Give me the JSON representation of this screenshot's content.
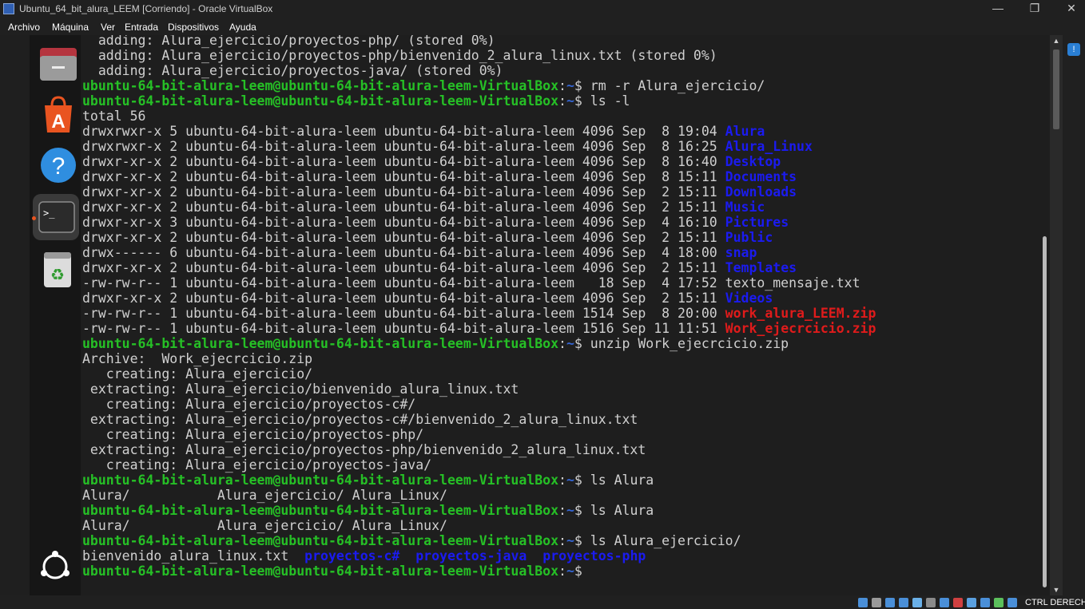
{
  "window": {
    "title": "Ubuntu_64_bit_alura_LEEM [Corriendo] - Oracle VirtualBox",
    "controls": {
      "minimize": "—",
      "restore": "❐",
      "close": "✕"
    }
  },
  "menubar": {
    "items": [
      "Archivo",
      "Máquina",
      "Ver",
      "Entrada",
      "Dispositivos",
      "Ayuda"
    ]
  },
  "dock": {
    "items": [
      {
        "name": "files",
        "icon": "folder-icon"
      },
      {
        "name": "app-center",
        "icon": "store-icon"
      },
      {
        "name": "help",
        "icon": "help-icon"
      },
      {
        "name": "terminal",
        "icon": "terminal-icon",
        "active": true
      },
      {
        "name": "trash",
        "icon": "trash-icon"
      }
    ],
    "show_apps": "apps-grid-icon"
  },
  "terminal": {
    "user_host": "ubuntu-64-bit-alura-leem@ubuntu-64-bit-alura-leem-VirtualBox",
    "path": "~",
    "lines": [
      [
        {
          "t": "  adding: Alura_ejercicio/proyectos-php/ (stored 0%)"
        }
      ],
      [
        {
          "t": "  adding: Alura_ejercicio/proyectos-php/bienvenido_2_alura_linux.txt (stored 0%)"
        }
      ],
      [
        {
          "t": "  adding: Alura_ejercicio/proyectos-java/ (stored 0%)"
        }
      ],
      [
        {
          "t": "ubuntu-64-bit-alura-leem@ubuntu-64-bit-alura-leem-VirtualBox",
          "c": "prompt"
        },
        {
          "t": ":"
        },
        {
          "t": "~",
          "c": "path"
        },
        {
          "t": "$ rm -r Alura_ejercicio/"
        }
      ],
      [
        {
          "t": "ubuntu-64-bit-alura-leem@ubuntu-64-bit-alura-leem-VirtualBox",
          "c": "prompt"
        },
        {
          "t": ":"
        },
        {
          "t": "~",
          "c": "path"
        },
        {
          "t": "$ ls -l"
        }
      ],
      [
        {
          "t": "total 56"
        }
      ],
      [
        {
          "t": "drwxrwxr-x 5 ubuntu-64-bit-alura-leem ubuntu-64-bit-alura-leem 4096 Sep  8 19:04 "
        },
        {
          "t": "Alura",
          "c": "dir"
        }
      ],
      [
        {
          "t": "drwxrwxr-x 2 ubuntu-64-bit-alura-leem ubuntu-64-bit-alura-leem 4096 Sep  8 16:25 "
        },
        {
          "t": "Alura_Linux",
          "c": "dir"
        }
      ],
      [
        {
          "t": "drwxr-xr-x 2 ubuntu-64-bit-alura-leem ubuntu-64-bit-alura-leem 4096 Sep  8 16:40 "
        },
        {
          "t": "Desktop",
          "c": "dir"
        }
      ],
      [
        {
          "t": "drwxr-xr-x 2 ubuntu-64-bit-alura-leem ubuntu-64-bit-alura-leem 4096 Sep  8 15:11 "
        },
        {
          "t": "Documents",
          "c": "dir"
        }
      ],
      [
        {
          "t": "drwxr-xr-x 2 ubuntu-64-bit-alura-leem ubuntu-64-bit-alura-leem 4096 Sep  2 15:11 "
        },
        {
          "t": "Downloads",
          "c": "dir"
        }
      ],
      [
        {
          "t": "drwxr-xr-x 2 ubuntu-64-bit-alura-leem ubuntu-64-bit-alura-leem 4096 Sep  2 15:11 "
        },
        {
          "t": "Music",
          "c": "dir"
        }
      ],
      [
        {
          "t": "drwxr-xr-x 3 ubuntu-64-bit-alura-leem ubuntu-64-bit-alura-leem 4096 Sep  4 16:10 "
        },
        {
          "t": "Pictures",
          "c": "dir"
        }
      ],
      [
        {
          "t": "drwxr-xr-x 2 ubuntu-64-bit-alura-leem ubuntu-64-bit-alura-leem 4096 Sep  2 15:11 "
        },
        {
          "t": "Public",
          "c": "dir"
        }
      ],
      [
        {
          "t": "drwx------ 6 ubuntu-64-bit-alura-leem ubuntu-64-bit-alura-leem 4096 Sep  4 18:00 "
        },
        {
          "t": "snap",
          "c": "dir"
        }
      ],
      [
        {
          "t": "drwxr-xr-x 2 ubuntu-64-bit-alura-leem ubuntu-64-bit-alura-leem 4096 Sep  2 15:11 "
        },
        {
          "t": "Templates",
          "c": "dir"
        }
      ],
      [
        {
          "t": "-rw-rw-r-- 1 ubuntu-64-bit-alura-leem ubuntu-64-bit-alura-leem   18 Sep  4 17:52 texto_mensaje.txt"
        }
      ],
      [
        {
          "t": "drwxr-xr-x 2 ubuntu-64-bit-alura-leem ubuntu-64-bit-alura-leem 4096 Sep  2 15:11 "
        },
        {
          "t": "Videos",
          "c": "dir"
        }
      ],
      [
        {
          "t": "-rw-rw-r-- 1 ubuntu-64-bit-alura-leem ubuntu-64-bit-alura-leem 1514 Sep  8 20:00 "
        },
        {
          "t": "work_alura_LEEM.zip",
          "c": "zip"
        }
      ],
      [
        {
          "t": "-rw-rw-r-- 1 ubuntu-64-bit-alura-leem ubuntu-64-bit-alura-leem 1516 Sep 11 11:51 "
        },
        {
          "t": "Work_ejecrcicio.zip",
          "c": "zip"
        }
      ],
      [
        {
          "t": "ubuntu-64-bit-alura-leem@ubuntu-64-bit-alura-leem-VirtualBox",
          "c": "prompt"
        },
        {
          "t": ":"
        },
        {
          "t": "~",
          "c": "path"
        },
        {
          "t": "$ unzip Work_ejecrcicio.zip"
        }
      ],
      [
        {
          "t": "Archive:  Work_ejecrcicio.zip"
        }
      ],
      [
        {
          "t": "   creating: Alura_ejercicio/"
        }
      ],
      [
        {
          "t": " extracting: Alura_ejercicio/bienvenido_alura_linux.txt"
        }
      ],
      [
        {
          "t": "   creating: Alura_ejercicio/proyectos-c#/"
        }
      ],
      [
        {
          "t": " extracting: Alura_ejercicio/proyectos-c#/bienvenido_2_alura_linux.txt"
        }
      ],
      [
        {
          "t": "   creating: Alura_ejercicio/proyectos-php/"
        }
      ],
      [
        {
          "t": " extracting: Alura_ejercicio/proyectos-php/bienvenido_2_alura_linux.txt"
        }
      ],
      [
        {
          "t": "   creating: Alura_ejercicio/proyectos-java/"
        }
      ],
      [
        {
          "t": "ubuntu-64-bit-alura-leem@ubuntu-64-bit-alura-leem-VirtualBox",
          "c": "prompt"
        },
        {
          "t": ":"
        },
        {
          "t": "~",
          "c": "path"
        },
        {
          "t": "$ ls Alura"
        }
      ],
      [
        {
          "t": "Alura/           Alura_ejercicio/ Alura_Linux/"
        }
      ],
      [
        {
          "t": "ubuntu-64-bit-alura-leem@ubuntu-64-bit-alura-leem-VirtualBox",
          "c": "prompt"
        },
        {
          "t": ":"
        },
        {
          "t": "~",
          "c": "path"
        },
        {
          "t": "$ ls Alura"
        }
      ],
      [
        {
          "t": "Alura/           Alura_ejercicio/ Alura_Linux/"
        }
      ],
      [
        {
          "t": "ubuntu-64-bit-alura-leem@ubuntu-64-bit-alura-leem-VirtualBox",
          "c": "prompt"
        },
        {
          "t": ":"
        },
        {
          "t": "~",
          "c": "path"
        },
        {
          "t": "$ ls Alura_ejercicio/"
        }
      ],
      [
        {
          "t": "bienvenido_alura_linux.txt  "
        },
        {
          "t": "proyectos-c#",
          "c": "dir"
        },
        {
          "t": "  "
        },
        {
          "t": "proyectos-java",
          "c": "dir"
        },
        {
          "t": "  "
        },
        {
          "t": "proyectos-php",
          "c": "dir"
        }
      ],
      [
        {
          "t": "ubuntu-64-bit-alura-leem@ubuntu-64-bit-alura-leem-VirtualBox",
          "c": "prompt"
        },
        {
          "t": ":"
        },
        {
          "t": "~",
          "c": "path"
        },
        {
          "t": "$ "
        }
      ]
    ]
  },
  "statusbar": {
    "icons": [
      "hard-disk-icon",
      "optical-drive-icon",
      "audio-icon",
      "network-icon",
      "usb-icon",
      "shared-folders-icon",
      "display-icon",
      "recording-icon",
      "vt-x-icon",
      "cpu-icon",
      "mouse-integration-icon",
      "keyboard-icon"
    ],
    "host_key": "CTRL DERECH"
  },
  "colors": {
    "prompt": "#26c026",
    "path": "#3465d4",
    "directory": "#1b1bf0",
    "archive": "#e01b1b",
    "text": "#d0d0d0",
    "background": "#1e1e1e"
  }
}
